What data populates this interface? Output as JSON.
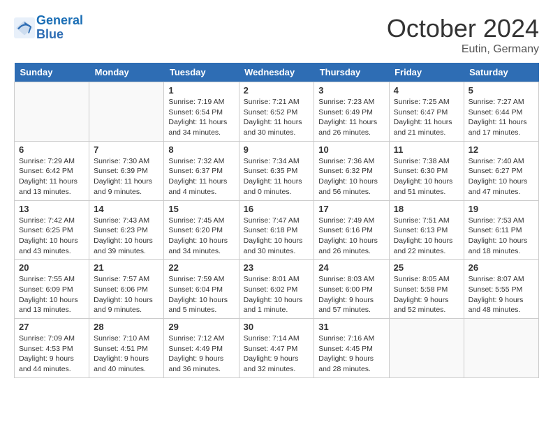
{
  "header": {
    "logo_line1": "General",
    "logo_line2": "Blue",
    "month": "October 2024",
    "location": "Eutin, Germany"
  },
  "weekdays": [
    "Sunday",
    "Monday",
    "Tuesday",
    "Wednesday",
    "Thursday",
    "Friday",
    "Saturday"
  ],
  "weeks": [
    [
      {
        "day": "",
        "info": ""
      },
      {
        "day": "",
        "info": ""
      },
      {
        "day": "1",
        "info": "Sunrise: 7:19 AM\nSunset: 6:54 PM\nDaylight: 11 hours and 34 minutes."
      },
      {
        "day": "2",
        "info": "Sunrise: 7:21 AM\nSunset: 6:52 PM\nDaylight: 11 hours and 30 minutes."
      },
      {
        "day": "3",
        "info": "Sunrise: 7:23 AM\nSunset: 6:49 PM\nDaylight: 11 hours and 26 minutes."
      },
      {
        "day": "4",
        "info": "Sunrise: 7:25 AM\nSunset: 6:47 PM\nDaylight: 11 hours and 21 minutes."
      },
      {
        "day": "5",
        "info": "Sunrise: 7:27 AM\nSunset: 6:44 PM\nDaylight: 11 hours and 17 minutes."
      }
    ],
    [
      {
        "day": "6",
        "info": "Sunrise: 7:29 AM\nSunset: 6:42 PM\nDaylight: 11 hours and 13 minutes."
      },
      {
        "day": "7",
        "info": "Sunrise: 7:30 AM\nSunset: 6:39 PM\nDaylight: 11 hours and 9 minutes."
      },
      {
        "day": "8",
        "info": "Sunrise: 7:32 AM\nSunset: 6:37 PM\nDaylight: 11 hours and 4 minutes."
      },
      {
        "day": "9",
        "info": "Sunrise: 7:34 AM\nSunset: 6:35 PM\nDaylight: 11 hours and 0 minutes."
      },
      {
        "day": "10",
        "info": "Sunrise: 7:36 AM\nSunset: 6:32 PM\nDaylight: 10 hours and 56 minutes."
      },
      {
        "day": "11",
        "info": "Sunrise: 7:38 AM\nSunset: 6:30 PM\nDaylight: 10 hours and 51 minutes."
      },
      {
        "day": "12",
        "info": "Sunrise: 7:40 AM\nSunset: 6:27 PM\nDaylight: 10 hours and 47 minutes."
      }
    ],
    [
      {
        "day": "13",
        "info": "Sunrise: 7:42 AM\nSunset: 6:25 PM\nDaylight: 10 hours and 43 minutes."
      },
      {
        "day": "14",
        "info": "Sunrise: 7:43 AM\nSunset: 6:23 PM\nDaylight: 10 hours and 39 minutes."
      },
      {
        "day": "15",
        "info": "Sunrise: 7:45 AM\nSunset: 6:20 PM\nDaylight: 10 hours and 34 minutes."
      },
      {
        "day": "16",
        "info": "Sunrise: 7:47 AM\nSunset: 6:18 PM\nDaylight: 10 hours and 30 minutes."
      },
      {
        "day": "17",
        "info": "Sunrise: 7:49 AM\nSunset: 6:16 PM\nDaylight: 10 hours and 26 minutes."
      },
      {
        "day": "18",
        "info": "Sunrise: 7:51 AM\nSunset: 6:13 PM\nDaylight: 10 hours and 22 minutes."
      },
      {
        "day": "19",
        "info": "Sunrise: 7:53 AM\nSunset: 6:11 PM\nDaylight: 10 hours and 18 minutes."
      }
    ],
    [
      {
        "day": "20",
        "info": "Sunrise: 7:55 AM\nSunset: 6:09 PM\nDaylight: 10 hours and 13 minutes."
      },
      {
        "day": "21",
        "info": "Sunrise: 7:57 AM\nSunset: 6:06 PM\nDaylight: 10 hours and 9 minutes."
      },
      {
        "day": "22",
        "info": "Sunrise: 7:59 AM\nSunset: 6:04 PM\nDaylight: 10 hours and 5 minutes."
      },
      {
        "day": "23",
        "info": "Sunrise: 8:01 AM\nSunset: 6:02 PM\nDaylight: 10 hours and 1 minute."
      },
      {
        "day": "24",
        "info": "Sunrise: 8:03 AM\nSunset: 6:00 PM\nDaylight: 9 hours and 57 minutes."
      },
      {
        "day": "25",
        "info": "Sunrise: 8:05 AM\nSunset: 5:58 PM\nDaylight: 9 hours and 52 minutes."
      },
      {
        "day": "26",
        "info": "Sunrise: 8:07 AM\nSunset: 5:55 PM\nDaylight: 9 hours and 48 minutes."
      }
    ],
    [
      {
        "day": "27",
        "info": "Sunrise: 7:09 AM\nSunset: 4:53 PM\nDaylight: 9 hours and 44 minutes."
      },
      {
        "day": "28",
        "info": "Sunrise: 7:10 AM\nSunset: 4:51 PM\nDaylight: 9 hours and 40 minutes."
      },
      {
        "day": "29",
        "info": "Sunrise: 7:12 AM\nSunset: 4:49 PM\nDaylight: 9 hours and 36 minutes."
      },
      {
        "day": "30",
        "info": "Sunrise: 7:14 AM\nSunset: 4:47 PM\nDaylight: 9 hours and 32 minutes."
      },
      {
        "day": "31",
        "info": "Sunrise: 7:16 AM\nSunset: 4:45 PM\nDaylight: 9 hours and 28 minutes."
      },
      {
        "day": "",
        "info": ""
      },
      {
        "day": "",
        "info": ""
      }
    ]
  ]
}
